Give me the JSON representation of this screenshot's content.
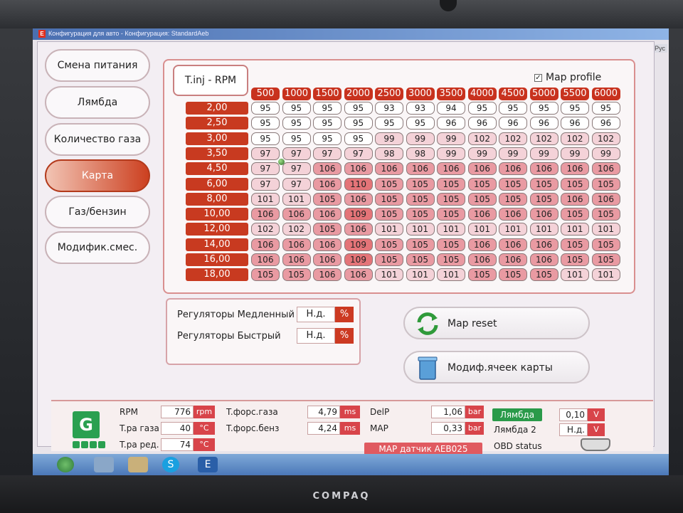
{
  "window": {
    "title": "Конфигурация для авто - Конфигурация: StandardAeb",
    "app_icon": "E",
    "lang": "RU Рус"
  },
  "nav": [
    {
      "label": "Смена питания",
      "active": false
    },
    {
      "label": "Лямбда",
      "active": false
    },
    {
      "label": "Количество газа",
      "active": false
    },
    {
      "label": "Карта",
      "active": true
    },
    {
      "label": "Газ/бензин",
      "active": false
    },
    {
      "label": "Модифик.смес.",
      "active": false
    }
  ],
  "map": {
    "axis_label": "T.inj - RPM",
    "profile_label": "Map profile",
    "profile_checked": true,
    "rpm": [
      "500",
      "1000",
      "1500",
      "2000",
      "2500",
      "3000",
      "3500",
      "4000",
      "4500",
      "5000",
      "5500",
      "6000"
    ],
    "tinj": [
      "2,00",
      "2,50",
      "3,00",
      "3,50",
      "4,50",
      "6,00",
      "8,00",
      "10,00",
      "12,00",
      "14,00",
      "16,00",
      "18,00"
    ],
    "cells": [
      [
        95,
        95,
        95,
        95,
        93,
        93,
        94,
        95,
        95,
        95,
        95,
        95
      ],
      [
        95,
        95,
        95,
        95,
        95,
        95,
        96,
        96,
        96,
        96,
        96,
        96
      ],
      [
        95,
        95,
        95,
        95,
        99,
        99,
        99,
        102,
        102,
        102,
        102,
        102
      ],
      [
        97,
        97,
        97,
        97,
        98,
        98,
        99,
        99,
        99,
        99,
        99,
        99
      ],
      [
        97,
        97,
        106,
        106,
        106,
        106,
        106,
        106,
        106,
        106,
        106,
        106
      ],
      [
        97,
        97,
        106,
        110,
        105,
        105,
        105,
        105,
        105,
        105,
        105,
        105
      ],
      [
        101,
        101,
        105,
        106,
        105,
        105,
        105,
        105,
        105,
        105,
        106,
        106
      ],
      [
        106,
        106,
        106,
        109,
        105,
        105,
        105,
        106,
        106,
        106,
        105,
        105
      ],
      [
        102,
        102,
        105,
        106,
        101,
        101,
        101,
        101,
        101,
        101,
        101,
        101
      ],
      [
        106,
        106,
        106,
        109,
        105,
        105,
        105,
        106,
        106,
        106,
        105,
        105
      ],
      [
        106,
        106,
        106,
        109,
        105,
        105,
        105,
        106,
        106,
        106,
        105,
        105
      ],
      [
        105,
        105,
        106,
        106,
        101,
        101,
        101,
        105,
        105,
        105,
        101,
        101
      ]
    ]
  },
  "regulators": {
    "slow_label": "Регуляторы Медленный",
    "slow_value": "Н.д.",
    "fast_label": "Регуляторы Быстрый",
    "fast_value": "Н.д.",
    "unit": "%"
  },
  "actions": {
    "map_reset": "Map reset",
    "modify_cells": "Модиф.ячеек карты"
  },
  "status": {
    "g_label": "G",
    "rpm_label": "RPM",
    "rpm_value": "776",
    "rpm_unit": "rpm",
    "t_gas_label": "T.ра газа",
    "t_gas_value": "40",
    "t_gas_unit": "°C",
    "t_red_label": "T.ра ред.",
    "t_red_value": "74",
    "t_red_unit": "°C",
    "inj_gas_label": "T.форс.газа",
    "inj_gas_value": "4,79",
    "inj_gas_unit": "ms",
    "inj_benz_label": "T.форс.бенз",
    "inj_benz_value": "4,24",
    "inj_benz_unit": "ms",
    "delp_label": "DelP",
    "delp_value": "1,06",
    "delp_unit": "bar",
    "map_label": "MAP",
    "map_value": "0,33",
    "map_unit": "bar",
    "map_sensor": "MAP датчик AEB025",
    "lambda_label": "Лямбда",
    "lambda_value": "0,10",
    "lambda_unit": "V",
    "lambda2_label": "Лямбда 2",
    "lambda2_value": "Н.д.",
    "lambda2_unit": "V",
    "obd_label": "OBD status"
  },
  "taskbar": {
    "skype": "S",
    "app": "E"
  },
  "brand": "COMPAQ",
  "colors": {
    "accent": "#c8321e",
    "lambda_ok": "#2a9a4a"
  }
}
